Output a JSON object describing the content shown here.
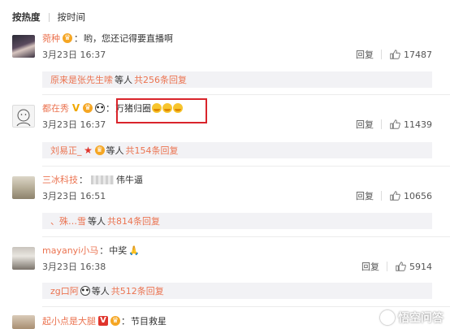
{
  "sort": {
    "hot": "按热度",
    "time": "按时间"
  },
  "comments": [
    {
      "user": "菀种",
      "text": "哟，您还记得要直播啊",
      "date": "3月23日 16:37",
      "reply_label": "回复",
      "likes": "17487",
      "sub": {
        "names": "原来是张先生嗦",
        "text": "等人",
        "count": "共256条回复"
      }
    },
    {
      "user": "都在秀",
      "text": "万猪归圈",
      "date": "3月23日 16:37",
      "reply_label": "回复",
      "likes": "11439",
      "sub": {
        "names": "刘易正_",
        "text": "等人",
        "count": "共154条回复"
      }
    },
    {
      "user": "三冰科技",
      "text": "伟牛逼",
      "date": "3月23日 16:51",
      "reply_label": "回复",
      "likes": "10656",
      "sub": {
        "names": "、殊…雪",
        "text": "等人",
        "count": "共814条回复"
      }
    },
    {
      "user": "mayanyi小马",
      "text": "中奖",
      "date": "3月23日 16:38",
      "reply_label": "回复",
      "likes": "5914",
      "sub": {
        "names": "zg口阿",
        "text": "等人",
        "count": "共512条回复"
      }
    },
    {
      "user": "起小点是大腿",
      "text": "节目救星"
    }
  ],
  "watermark": "悟空问答",
  "colors": {
    "username": "#eb7350",
    "highlight": "#d9242b",
    "subreply_bg": "#f2f2f5"
  },
  "icons": [
    "thumbs-up-icon",
    "vip-badge-icon",
    "verified-v-icon",
    "panda-icon",
    "star-icon",
    "crying-laugh-emoji",
    "pray-emoji"
  ]
}
